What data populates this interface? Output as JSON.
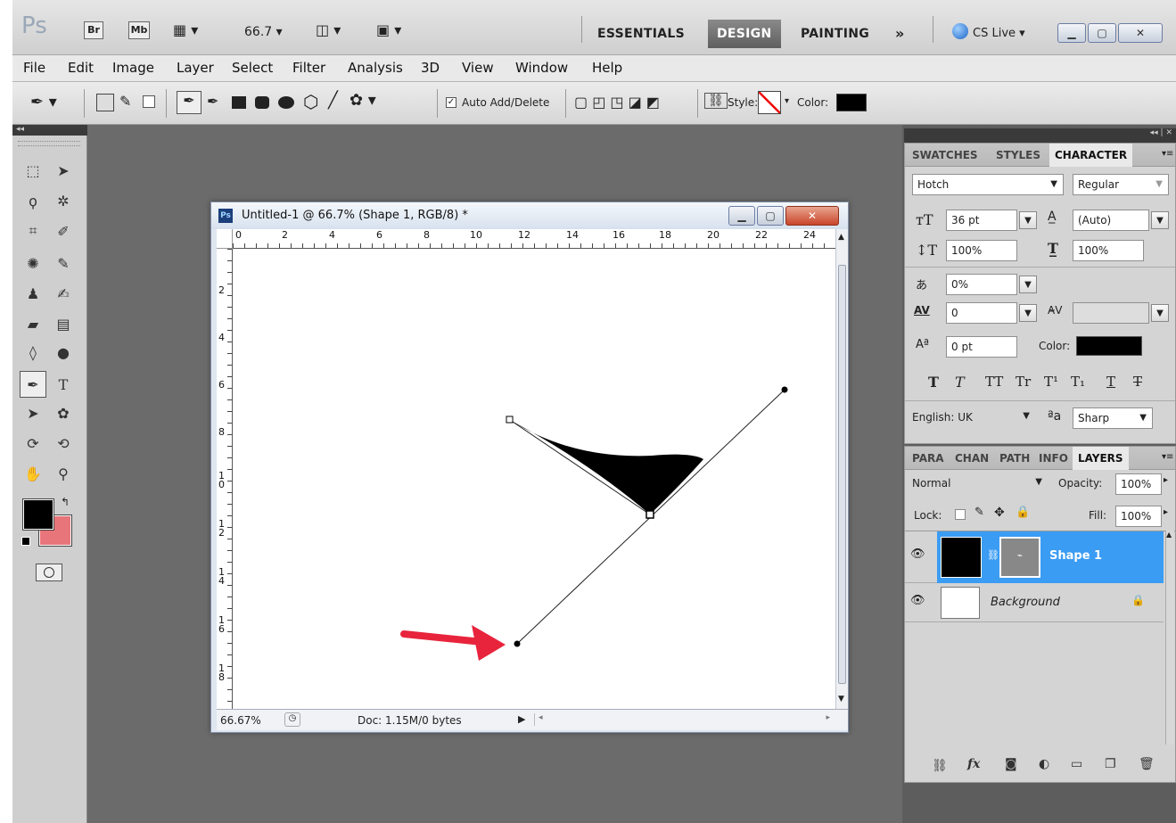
{
  "app": {
    "logo": "Ps",
    "bridge": "Br",
    "minibridge": "Mb",
    "zoom_value": "66.7",
    "workspaces": [
      "ESSENTIALS",
      "DESIGN",
      "PAINTING"
    ],
    "more": "»",
    "cs_live": "CS Live"
  },
  "menu": [
    "File",
    "Edit",
    "Image",
    "Layer",
    "Select",
    "Filter",
    "Analysis",
    "3D",
    "View",
    "Window",
    "Help"
  ],
  "options": {
    "auto_add_delete": "Auto Add/Delete",
    "style_label": "Style:",
    "color_label": "Color:"
  },
  "document": {
    "title": "Untitled-1 @ 66.7% (Shape 1, RGB/8) *",
    "ps_badge": "Ps",
    "ruler_top": [
      "0",
      "2",
      "4",
      "6",
      "8",
      "10",
      "12",
      "14",
      "16",
      "18",
      "20",
      "22",
      "24"
    ],
    "ruler_left": [
      "2",
      "4",
      "6",
      "8",
      "1\n0",
      "1\n2",
      "1\n4",
      "1\n6",
      "1\n8"
    ],
    "zoom_status": "66.67%",
    "doc_info": "Doc: 1.15M/0 bytes"
  },
  "character": {
    "tabs": [
      "SWATCHES",
      "STYLES",
      "CHARACTER"
    ],
    "font_family": "Hotch",
    "font_style": "Regular",
    "size": "36 pt",
    "leading": "(Auto)",
    "vscale": "100%",
    "hscale": "100%",
    "tsume": "0%",
    "kerning": "0",
    "tracking": "",
    "baseline": "0 pt",
    "color_label": "Color:",
    "type_buttons": [
      "T",
      "T",
      "TT",
      "Tr",
      "T¹",
      "T₁",
      "T",
      "T"
    ],
    "language": "English: UK",
    "aa_symbol": "a",
    "antialias": "Sharp"
  },
  "layers": {
    "tabs": [
      "PARA",
      "CHAN",
      "PATH",
      "INFO",
      "LAYERS"
    ],
    "blend_mode": "Normal",
    "opacity_label": "Opacity:",
    "opacity": "100%",
    "lock_label": "Lock:",
    "fill_label": "Fill:",
    "fill": "100%",
    "items": [
      {
        "name": "Shape 1",
        "selected": true
      },
      {
        "name": "Background",
        "selected": false
      }
    ]
  },
  "colors": {
    "foreground": "#000000",
    "background": "#e8757a",
    "arrow": "#e8243c",
    "selection": "#3b9cf3"
  }
}
